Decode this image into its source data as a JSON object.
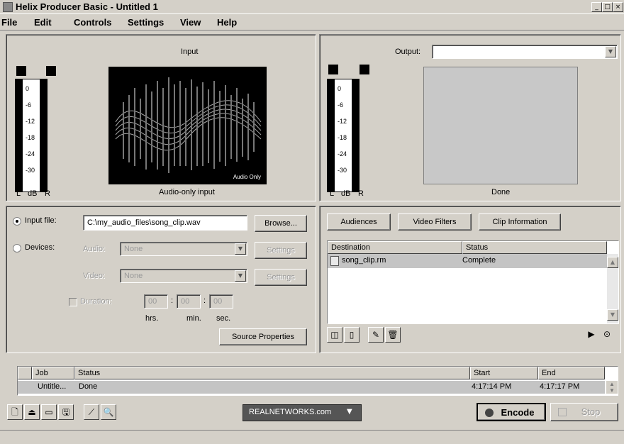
{
  "window": {
    "title": "Helix Producer Basic - Untitled 1"
  },
  "menu": [
    "File",
    "Edit",
    "Controls",
    "Settings",
    "View",
    "Help"
  ],
  "meters": {
    "scale": [
      "0",
      "-6",
      "-12",
      "-18",
      "-24",
      "-30"
    ],
    "left_label": "L",
    "db_label": "dB",
    "right_label": "R"
  },
  "input": {
    "heading": "Input",
    "caption": "Audio-only input",
    "overlay": "Audio Only"
  },
  "output": {
    "label": "Output:",
    "value": "",
    "caption": "Done"
  },
  "source": {
    "input_file_label": "Input file:",
    "input_file_value": "C:\\my_audio_files\\song_clip.wav",
    "browse_label": "Browse...",
    "devices_label": "Devices:",
    "audio_label": "Audio:",
    "audio_value": "None",
    "video_label": "Video:",
    "video_value": "None",
    "settings_label": "Settings",
    "duration_label": "Duration:",
    "hrs_value": "00",
    "min_value": "00",
    "sec_value": "00",
    "sep": ":",
    "hrs_label": "hrs.",
    "min_label": "min.",
    "sec_label": "sec.",
    "source_properties_label": "Source Properties"
  },
  "dest": {
    "audiences_label": "Audiences",
    "video_filters_label": "Video Filters",
    "clip_info_label": "Clip Information",
    "col_destination": "Destination",
    "col_status": "Status",
    "rows": [
      {
        "destination": "song_clip.rm",
        "status": "Complete"
      }
    ]
  },
  "jobs": {
    "col_job": "Job",
    "col_status": "Status",
    "col_start": "Start",
    "col_end": "End",
    "rows": [
      {
        "job": "Untitle...",
        "status": "Done",
        "start": "4:17:14 PM",
        "end": "4:17:17 PM"
      }
    ]
  },
  "bottom": {
    "realnetworks_label": "REALNETWORKS.com",
    "encode_label": "Encode",
    "stop_label": "Stop"
  }
}
